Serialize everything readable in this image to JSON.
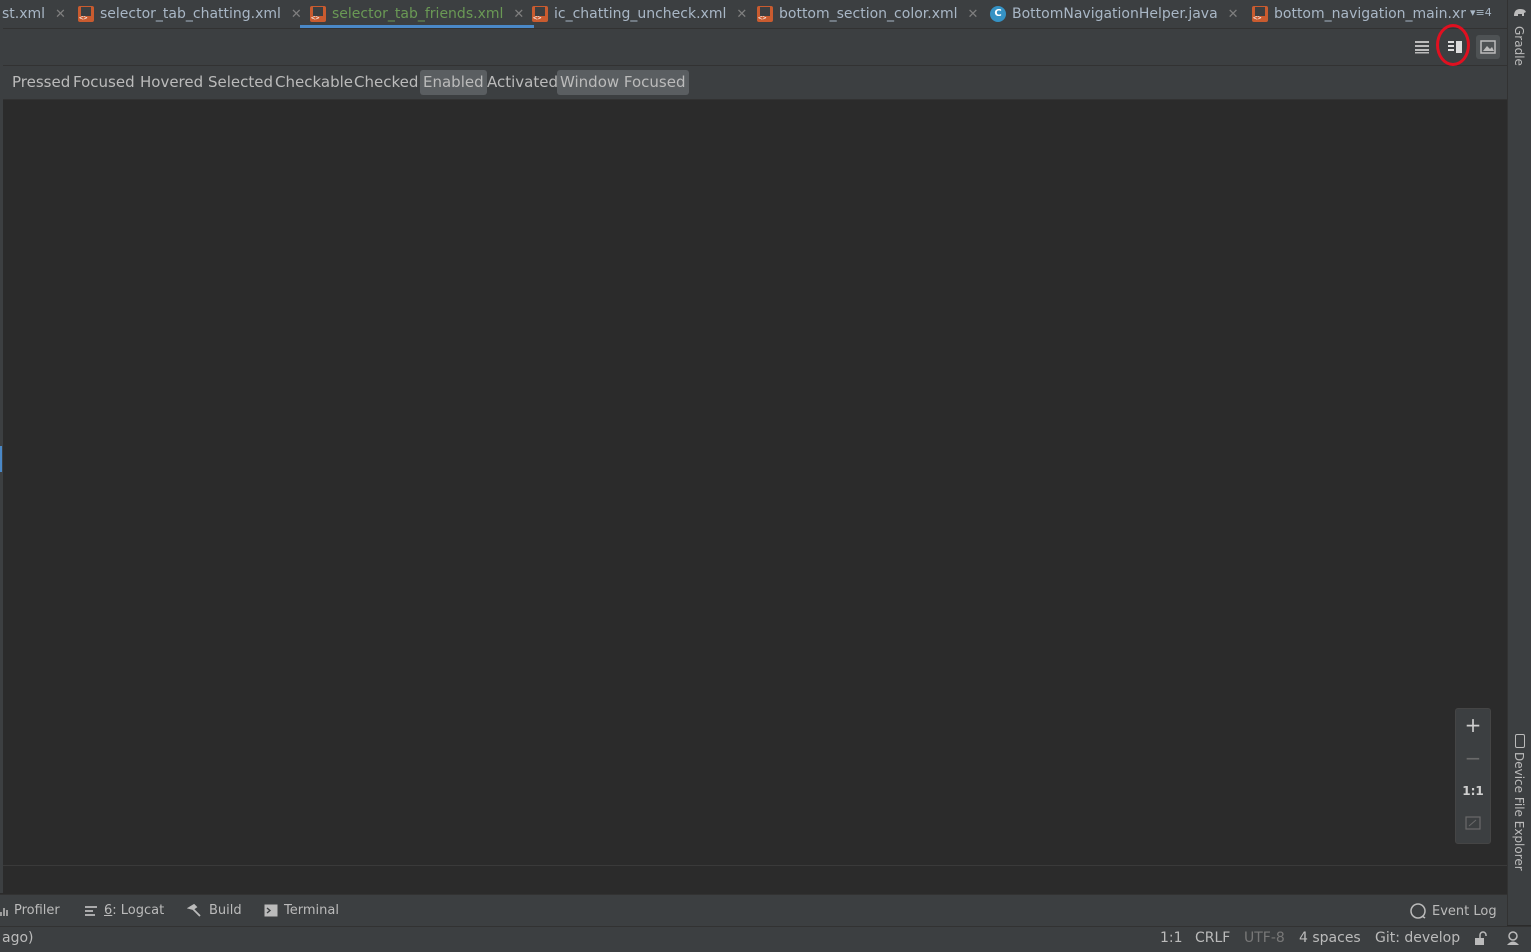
{
  "tabs": [
    {
      "label": "st.xml",
      "icon": "xml-file-icon",
      "active": false
    },
    {
      "label": "selector_tab_chatting.xml",
      "icon": "xml-file-icon",
      "active": false
    },
    {
      "label": "selector_tab_friends.xml",
      "icon": "xml-file-icon",
      "active": true
    },
    {
      "label": "ic_chatting_uncheck.xml",
      "icon": "xml-file-icon",
      "active": false
    },
    {
      "label": "bottom_section_color.xml",
      "icon": "xml-file-icon",
      "active": false
    },
    {
      "label": "BottomNavigationHelper.java",
      "icon": "java-class-icon",
      "active": false
    },
    {
      "label": "bottom_navigation_main.xr",
      "icon": "xml-file-icon",
      "active": false
    }
  ],
  "tab_overflow": "▾≡4",
  "java_icon_letter": "C",
  "right_strip": {
    "gradle": "Gradle",
    "device_file_explorer": "Device File Explorer"
  },
  "toolbar": {
    "modes": [
      "code-mode-icon",
      "split-mode-icon",
      "design-mode-icon"
    ],
    "selected_mode": "split-mode-icon"
  },
  "states": [
    {
      "label": "Pressed",
      "on": false
    },
    {
      "label": "Focused",
      "on": false
    },
    {
      "label": "Hovered",
      "on": false
    },
    {
      "label": "Selected",
      "on": false
    },
    {
      "label": "Checkable",
      "on": false
    },
    {
      "label": "Checked",
      "on": false
    },
    {
      "label": "Enabled",
      "on": true
    },
    {
      "label": "Activated",
      "on": false
    },
    {
      "label": "Window Focused",
      "on": true
    }
  ],
  "zoom": {
    "zoom_in": "+",
    "zoom_out": "−",
    "actual_size": "1:1"
  },
  "bottom_tools": {
    "profiler": "Profiler",
    "logcat_num": "6",
    "logcat": ": Logcat",
    "build": "Build",
    "terminal": "Terminal",
    "event_log": "Event Log"
  },
  "status": {
    "message": "ago)",
    "position": "1:1",
    "line_sep": "CRLF",
    "encoding": "UTF-8",
    "indent": "4 spaces",
    "vcs": "Git: develop"
  },
  "colors": {
    "accent": "#4a88c7",
    "highlight_circle": "#e01020",
    "active_tab_text": "#6a9955"
  }
}
